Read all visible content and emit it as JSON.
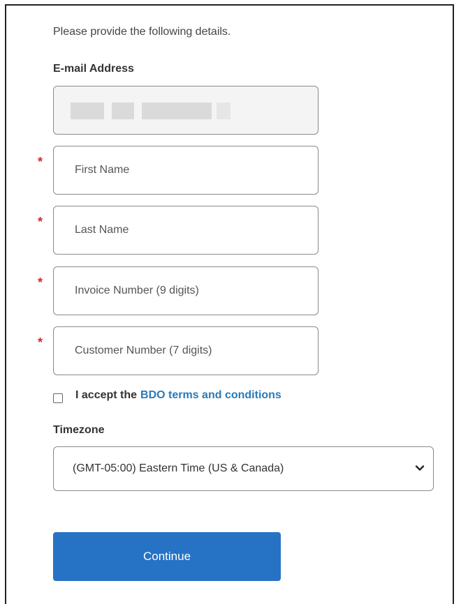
{
  "form": {
    "intro": "Please provide the following details.",
    "email_label": "E-mail Address",
    "required_mark": "*",
    "first_name_placeholder": "First Name",
    "last_name_placeholder": "Last Name",
    "invoice_placeholder": "Invoice Number (9 digits)",
    "customer_placeholder": "Customer Number (7 digits)",
    "terms_prefix": "I accept the",
    "terms_link": "BDO terms and conditions",
    "terms_checked": false,
    "timezone_label": "Timezone",
    "timezone_value": "(GMT-05:00) Eastern Time (US & Canada)",
    "continue_label": "Continue"
  },
  "colors": {
    "required": "#d22a2a",
    "link": "#2a7ab8",
    "button": "#2672c5"
  },
  "icons": {
    "select_arrow": "chevron-down-icon"
  }
}
